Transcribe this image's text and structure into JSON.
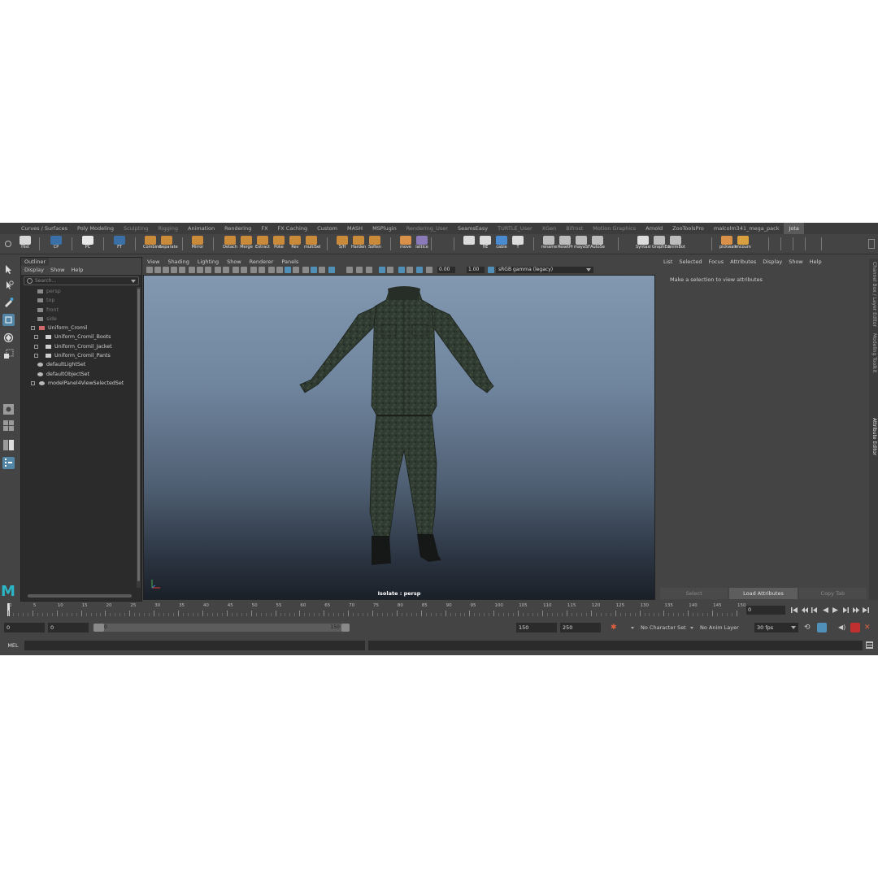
{
  "shelf_tabs": [
    {
      "label": "Curves / Surfaces",
      "state": "normal"
    },
    {
      "label": "Poly Modeling",
      "state": "normal"
    },
    {
      "label": "Sculpting",
      "state": "dim"
    },
    {
      "label": "Rigging",
      "state": "dim"
    },
    {
      "label": "Animation",
      "state": "normal"
    },
    {
      "label": "Rendering",
      "state": "normal"
    },
    {
      "label": "FX",
      "state": "normal"
    },
    {
      "label": "FX Caching",
      "state": "normal"
    },
    {
      "label": "Custom",
      "state": "normal"
    },
    {
      "label": "MASH",
      "state": "normal"
    },
    {
      "label": "MSPlugin",
      "state": "normal"
    },
    {
      "label": "Rendering_User",
      "state": "dim"
    },
    {
      "label": "SeamsEasy",
      "state": "normal"
    },
    {
      "label": "TURTLE_User",
      "state": "dim"
    },
    {
      "label": "XGen",
      "state": "dim"
    },
    {
      "label": "Bifrost",
      "state": "dim"
    },
    {
      "label": "Motion Graphics",
      "state": "dim"
    },
    {
      "label": "Arnold",
      "state": "normal"
    },
    {
      "label": "ZooToolsPro",
      "state": "normal"
    },
    {
      "label": "malcolm341_mega_pack",
      "state": "normal"
    },
    {
      "label": "Jota",
      "state": "active"
    }
  ],
  "shelf_buttons": [
    {
      "label": "Hist",
      "icon": "hist-icon",
      "color": "#d8d8d8"
    },
    {
      "label": "CP",
      "icon": "cp-icon",
      "color": "#3a6fa8"
    },
    {
      "label": "PC",
      "icon": "pc-icon",
      "color": "#e8e8e8"
    },
    {
      "label": "FT",
      "icon": "ft-icon",
      "color": "#3a6fa8"
    },
    {
      "label": "Combine",
      "icon": "combine-icon",
      "color": "#c98a3a"
    },
    {
      "label": "Separate",
      "icon": "separate-icon",
      "color": "#c98a3a"
    },
    {
      "label": "Mirror",
      "icon": "mirror-icon",
      "color": "#c98a3a"
    },
    {
      "label": "Detach",
      "icon": "detach-icon",
      "color": "#c98a3a"
    },
    {
      "label": "Merge",
      "icon": "merge-icon",
      "color": "#c98a3a"
    },
    {
      "label": "Extract",
      "icon": "extract-icon",
      "color": "#c98a3a"
    },
    {
      "label": "Poke",
      "icon": "poke-icon",
      "color": "#c98a3a"
    },
    {
      "label": "Rev",
      "icon": "rev-icon",
      "color": "#c98a3a"
    },
    {
      "label": "multiSel",
      "icon": "multisel-icon",
      "color": "#c98a3a"
    },
    {
      "label": "S/H",
      "icon": "sh-icon",
      "color": "#c98a3a"
    },
    {
      "label": "Harden",
      "icon": "harden-icon",
      "color": "#c98a3a"
    },
    {
      "label": "Soften",
      "icon": "soften-icon",
      "color": "#c98a3a"
    },
    {
      "label": "move",
      "icon": "move-icon",
      "color": "#d9914a"
    },
    {
      "label": "lattice",
      "icon": "lattice-icon",
      "color": "#8a7ab8"
    },
    {
      "label": "",
      "icon": "maya-m-icon",
      "color": "#dcdcdc"
    },
    {
      "label": "HE",
      "icon": "he-icon",
      "color": "#dcdcdc"
    },
    {
      "label": "cable",
      "icon": "cable-icon",
      "color": "#4a8ad0"
    },
    {
      "label": "T",
      "icon": "t-icon",
      "color": "#dcdcdc"
    },
    {
      "label": "rename",
      "icon": "rename-icon",
      "color": "#bcbcbc"
    },
    {
      "label": "ResetPr",
      "icon": "resetpr-icon",
      "color": "#bcbcbc"
    },
    {
      "label": "mayaSF",
      "icon": "mayasf-icon",
      "color": "#bcbcbc"
    },
    {
      "label": "AutoSe",
      "icon": "autose-icon",
      "color": "#bcbcbc"
    },
    {
      "label": "Syntaxi",
      "icon": "syntax-icon",
      "color": "#dcdcdc"
    },
    {
      "label": "GraphEd",
      "icon": "graphed-icon",
      "color": "#bcbcbc"
    },
    {
      "label": "animBot",
      "icon": "animbot-icon",
      "color": "#bcbcbc"
    },
    {
      "label": "pickwalk",
      "icon": "pickwalk-icon",
      "color": "#d9914a"
    },
    {
      "label": "mcoum",
      "icon": "mcoum-icon",
      "color": "#d9a040"
    }
  ],
  "outliner": {
    "title": "Outliner",
    "menu": [
      "Display",
      "Show",
      "Help"
    ],
    "search_placeholder": "Search...",
    "items": [
      {
        "label": "persp",
        "indent": 1,
        "icon": "camera-icon",
        "dim": true
      },
      {
        "label": "top",
        "indent": 1,
        "icon": "camera-icon",
        "dim": true
      },
      {
        "label": "front",
        "indent": 1,
        "icon": "camera-icon",
        "dim": true
      },
      {
        "label": "side",
        "indent": 1,
        "icon": "camera-icon",
        "dim": true
      },
      {
        "label": "Uniform_Cromil",
        "indent": 0,
        "icon": "group-icon",
        "dim": false
      },
      {
        "label": "Uniform_Cromil_Boots",
        "indent": 2,
        "icon": "mesh-icon",
        "dim": false
      },
      {
        "label": "Uniform_Cromil_Jacket",
        "indent": 2,
        "icon": "mesh-icon",
        "dim": false
      },
      {
        "label": "Uniform_Cromil_Pants",
        "indent": 2,
        "icon": "mesh-icon",
        "dim": false
      },
      {
        "label": "defaultLightSet",
        "indent": 1,
        "icon": "set-icon",
        "dim": false
      },
      {
        "label": "defaultObjectSet",
        "indent": 1,
        "icon": "set-icon",
        "dim": false
      },
      {
        "label": "modelPanel4ViewSelectedSet",
        "indent": 0,
        "icon": "set-icon",
        "dim": false
      }
    ]
  },
  "viewport": {
    "menu": [
      "View",
      "Shading",
      "Lighting",
      "Show",
      "Renderer",
      "Panels"
    ],
    "exposure": "0.00",
    "gamma": "1.00",
    "color_space": "sRGB gamma (legacy)",
    "label": "Isolate : persp"
  },
  "attribute_editor": {
    "menu": [
      "List",
      "Selected",
      "Focus",
      "Attributes",
      "Display",
      "Show",
      "Help"
    ],
    "message": "Make a selection to view attributes",
    "buttons": [
      {
        "label": "Select",
        "on": false
      },
      {
        "label": "Load Attributes",
        "on": true
      },
      {
        "label": "Copy Tab",
        "on": false
      }
    ],
    "side_tabs": [
      "Channel Box / Layer Editor",
      "Modeling Toolkit",
      "Attribute Editor"
    ]
  },
  "timeline": {
    "ticks": [
      "0",
      "5",
      "10",
      "15",
      "20",
      "25",
      "30",
      "35",
      "40",
      "45",
      "50",
      "55",
      "60",
      "65",
      "70",
      "75",
      "80",
      "85",
      "90",
      "95",
      "100",
      "105",
      "110",
      "115",
      "120",
      "125",
      "130",
      "135",
      "140",
      "145",
      "150"
    ],
    "current_frame": "0"
  },
  "range": {
    "start": "0",
    "inner_start": "0",
    "slider_start": "0",
    "slider_end": "150",
    "end": "150",
    "anim_end": "250",
    "character_set": "No Character Set",
    "anim_layer": "No Anim Layer",
    "fps": "30 fps"
  },
  "command": {
    "label": "MEL"
  }
}
